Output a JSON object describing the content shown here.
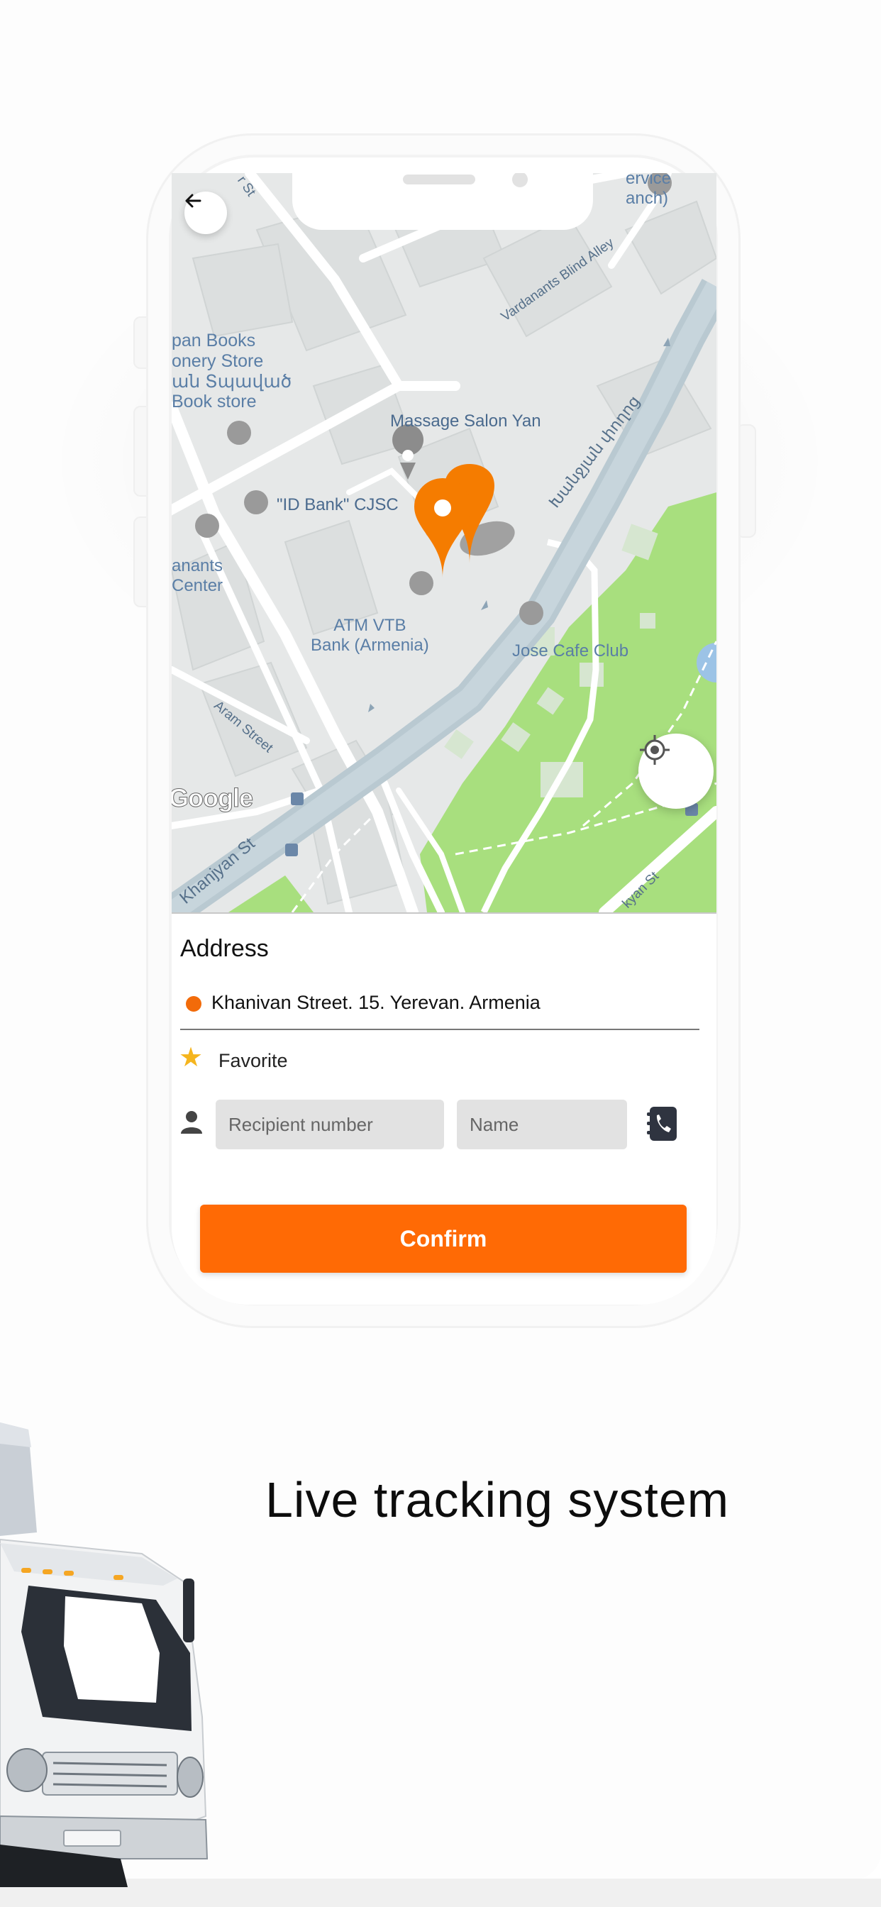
{
  "map": {
    "poi_labels": {
      "books": "pan Books\nonery Store\nան Տպաված\nBook store",
      "massage": "Massage Salon Yan",
      "bank": "\"ID Bank\" CJSC",
      "atm": "ATM VTB\nBank (Armenia)",
      "cafe": "Jose Cafe Club",
      "center": "anants\nCenter",
      "service": "ervice\nanch)"
    },
    "street_labels": {
      "st_top": "r St",
      "vardanants": "Vardanants Blind Alley",
      "armenian": "Խանջյան փողոց",
      "aram": "Aram Street",
      "khanjyan": "Khanjyan St",
      "bottom_right": "kyan St"
    },
    "attribution": "Google"
  },
  "address": {
    "title": "Address",
    "value": "Khanivan Street. 15. Yerevan. Armenia"
  },
  "favorite": {
    "label": "Favorite"
  },
  "recipient": {
    "number_placeholder": "Recipient number",
    "name_placeholder": "Name"
  },
  "confirm_label": "Confirm",
  "headline": "Live tracking system",
  "colors": {
    "accent": "#ff6a05",
    "pin": "#f57c00",
    "park": "#a8df7e",
    "road_major": "#b9c9d1",
    "map_bg": "#e6e8e8"
  },
  "icons": [
    "back-arrow-icon",
    "my-location-icon",
    "map-pin-icon",
    "star-icon",
    "person-icon",
    "contact-book-icon"
  ]
}
